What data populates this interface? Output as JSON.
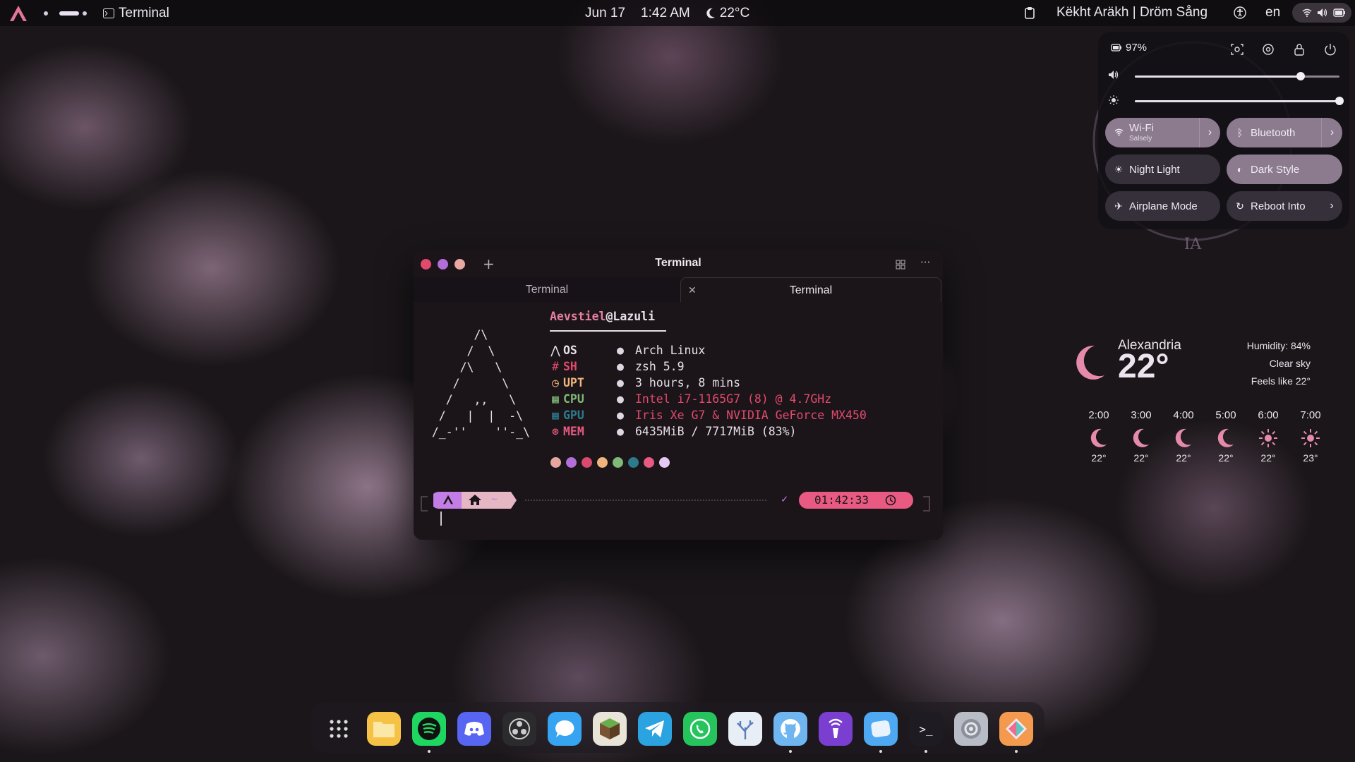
{
  "topbar": {
    "app_name": "Terminal",
    "date": "Jun 17",
    "time": "1:42 AM",
    "weather_temp": "22°C",
    "now_playing": "Këkht Aräkh | Dröm Sång",
    "language": "en"
  },
  "quick_settings": {
    "battery": "97%",
    "volume_level": 0.81,
    "brightness_level": 1.0,
    "wifi_label": "Wi-Fi",
    "wifi_network": "Salsely",
    "bluetooth_label": "Bluetooth",
    "night_light_label": "Night Light",
    "dark_style_label": "Dark Style",
    "airplane_label": "Airplane Mode",
    "reboot_label": "Reboot Into"
  },
  "weather": {
    "city": "Alexandria",
    "temp": "22°",
    "humidity": "Humidity: 84%",
    "condition": "Clear sky",
    "feels_like": "Feels like 22°",
    "forecast": [
      {
        "hour": "2:00",
        "icon": "moon-icon",
        "temp": "22°"
      },
      {
        "hour": "3:00",
        "icon": "moon-icon",
        "temp": "22°"
      },
      {
        "hour": "4:00",
        "icon": "moon-icon",
        "temp": "22°"
      },
      {
        "hour": "5:00",
        "icon": "moon-icon",
        "temp": "22°"
      },
      {
        "hour": "6:00",
        "icon": "sun-icon",
        "temp": "22°"
      },
      {
        "hour": "7:00",
        "icon": "sun-icon",
        "temp": "23°"
      }
    ]
  },
  "terminal": {
    "title": "Terminal",
    "tabs": [
      "Terminal",
      "Terminal"
    ],
    "user": "Aevstiel",
    "at": "@",
    "host": "Lazuli",
    "info": [
      {
        "key": "OS",
        "value": "Arch Linux"
      },
      {
        "key": "SH",
        "value": "zsh 5.9"
      },
      {
        "key": "UPT",
        "value": "3 hours, 8 mins"
      },
      {
        "key": "CPU",
        "value": "Intel i7-1165G7 (8) @ 4.7GHz"
      },
      {
        "key": "GPU",
        "value": "Iris Xe G7 & NVIDIA GeForce MX450"
      },
      {
        "key": "MEM",
        "value": "6435MiB / 7717MiB (83%)"
      }
    ],
    "palette": [
      "#e6a7a1",
      "#b070d8",
      "#d84a6e",
      "#f0b57c",
      "#80b878",
      "#2c7a8c",
      "#e85a82",
      "#e5c9f2"
    ],
    "prompt_dir": "~",
    "prompt_status": "✓",
    "prompt_time": "01:42:33"
  },
  "dock": [
    "app-grid-icon",
    "files-icon",
    "spotify-icon",
    "discord-icon",
    "obs-icon",
    "chat-icon",
    "minecraft-icon",
    "telegram-icon",
    "whatsapp-icon",
    "coral-icon",
    "github-icon",
    "podcast-icon",
    "browser-icon",
    "terminal-icon",
    "settings-icon",
    "photos-icon"
  ],
  "colors": {
    "accent_pink": "#e57fa0",
    "accent_purple": "#c37de6",
    "bar_bg": "#0e0c10"
  }
}
